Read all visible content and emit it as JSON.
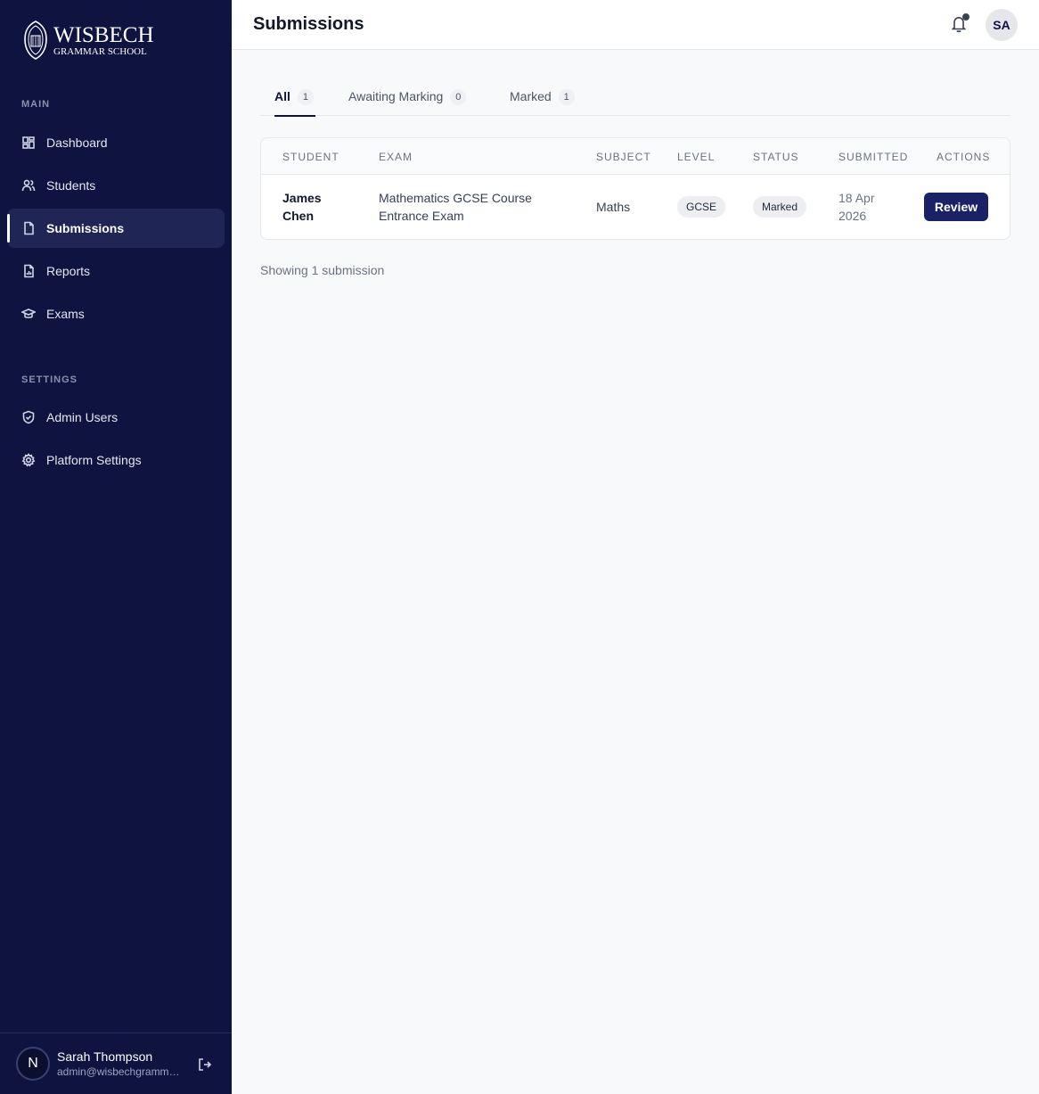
{
  "brand": {
    "name": "WISBECH",
    "subtitle": "GRAMMAR SCHOOL"
  },
  "sidebar": {
    "main_label": "MAIN",
    "main_items": [
      {
        "label": "Dashboard",
        "icon": "dashboard-icon"
      },
      {
        "label": "Students",
        "icon": "users-icon"
      },
      {
        "label": "Submissions",
        "icon": "document-icon",
        "active": true
      },
      {
        "label": "Reports",
        "icon": "report-icon"
      },
      {
        "label": "Exams",
        "icon": "graduation-cap-icon"
      }
    ],
    "settings_label": "SETTINGS",
    "settings_items": [
      {
        "label": "Admin Users",
        "icon": "shield-icon"
      },
      {
        "label": "Platform Settings",
        "icon": "gear-icon"
      }
    ]
  },
  "user": {
    "initial": "N",
    "name": "Sarah Thompson",
    "email": "admin@wisbechgrammar.com"
  },
  "header": {
    "title": "Submissions",
    "avatar_initials": "SA"
  },
  "tabs": [
    {
      "label": "All",
      "count": "1",
      "active": true
    },
    {
      "label": "Awaiting Marking",
      "count": "0"
    },
    {
      "label": "Marked",
      "count": "1"
    }
  ],
  "table": {
    "columns": [
      "STUDENT",
      "EXAM",
      "SUBJECT",
      "LEVEL",
      "STATUS",
      "SUBMITTED",
      "ACTIONS"
    ],
    "rows": [
      {
        "student_first": "James",
        "student_last": "Chen",
        "exam_line1": "Mathematics GCSE Course",
        "exam_line2": "Entrance Exam",
        "subject": "Maths",
        "level": "GCSE",
        "status": "Marked",
        "submitted_line1": "18 Apr",
        "submitted_line2": "2026",
        "action": "Review"
      }
    ]
  },
  "footer_text": "Showing 1 submission",
  "colors": {
    "sidebar_bg": "#0f1340",
    "accent": "#1a2166"
  }
}
